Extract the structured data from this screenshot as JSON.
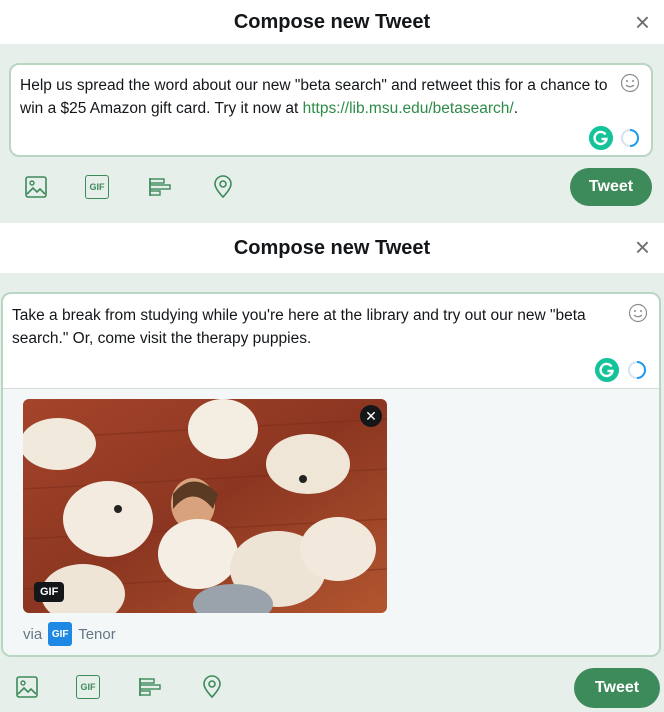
{
  "compose1": {
    "title": "Compose new Tweet",
    "text_before_link": "Help us spread the word about our new \"beta search\" and retweet this for a chance to win a $25 Amazon gift card. Try it now at ",
    "link": "https://lib.msu.edu/betasearch/",
    "text_after_link": ".",
    "tweet_label": "Tweet"
  },
  "compose2": {
    "title": "Compose new Tweet",
    "text": "Take a break from studying while you're here at the library and try out our new \"beta search.\" Or, come visit the therapy puppies.",
    "gif_badge": "GIF",
    "via_label": "via",
    "tenor_logo": "GIF",
    "tenor_label": "Tenor",
    "tweet_label": "Tweet"
  },
  "toolbar": {
    "icons": [
      "image-icon",
      "gif-icon",
      "poll-icon",
      "location-icon"
    ],
    "gif_text": "GIF"
  },
  "colors": {
    "accent": "#3d8a5b",
    "border": "#b9d6c3",
    "link": "#2e8b47",
    "background": "#e6efe9"
  }
}
